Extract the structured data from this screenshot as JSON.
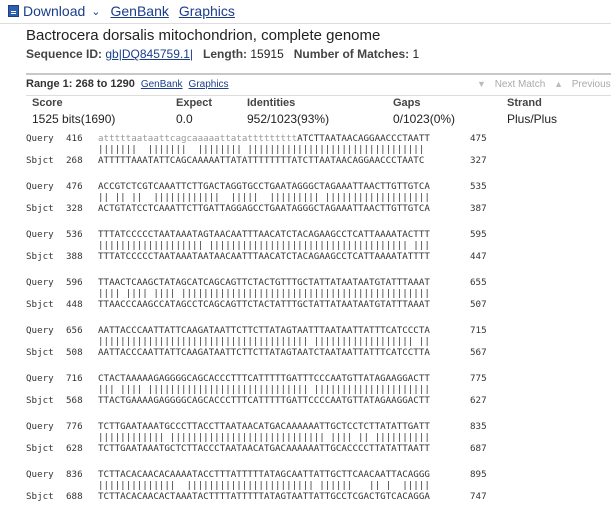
{
  "toolbar": {
    "download_label": "Download",
    "genbank_label": "GenBank",
    "graphics_label": "Graphics"
  },
  "header": {
    "title": "Bactrocera dorsalis mitochondrion, complete genome",
    "sequence_id_label": "Sequence ID:",
    "sequence_id_value": "gb|DQ845759.1|",
    "length_label": "Length:",
    "length_value": "15915",
    "matches_label": "Number of Matches:",
    "matches_value": "1"
  },
  "range": {
    "label": "Range 1: 268 to 1290",
    "genbank_link": "GenBank",
    "graphics_link": "Graphics",
    "next_match": "Next Match",
    "previous_match": "Previous Match"
  },
  "stats": {
    "headers": [
      "Score",
      "Expect",
      "Identities",
      "Gaps",
      "Strand"
    ],
    "values": [
      "1525 bits(1690)",
      "0.0",
      "952/1023(93%)",
      "0/1023(0%)",
      "Plus/Plus"
    ]
  },
  "alignment": [
    {
      "query_label": "Query",
      "query_start": "416",
      "query_lower": "atttttaataattcagcaaaaattatattttttttt",
      "query_seq": "ATCTTAATAACAGGAACCCTAATT",
      "query_end": "475",
      "match": "|||||||  |||||||  |||||||| ||||||||||||||||||||||||||||||||",
      "sbjct_label": "Sbjct",
      "sbjct_start": "268",
      "sbjct_seq": "ATTTTTAAATATTCAGCAAAAATTATATTTTTTTTATCTTAATAACAGGAACCCTAATC",
      "sbjct_end": "327"
    },
    {
      "query_label": "Query",
      "query_start": "476",
      "query_seq": "ACCGTCTCGTCAAATTCTTGACTAGGTGCCTGAATAGGGCTAGAAATTAACTTGTTGTCA",
      "query_end": "535",
      "match": "|| || ||  ||||||||||||  |||||  ||||||||| |||||||||||||||||||",
      "sbjct_label": "Sbjct",
      "sbjct_start": "328",
      "sbjct_seq": "ACTGTATCCTCAAATTCTTGATTAGGAGCCTGAATAGGGCTAGAAATTAACTTGTTGTCA",
      "sbjct_end": "387"
    },
    {
      "query_label": "Query",
      "query_start": "536",
      "query_seq": "TTTATCCCCCTAATAAATAGTAACAATTTAACATCTACAGAAGCCTCATTAAAATACTTT",
      "query_end": "595",
      "match": "||||||||||||||||||| |||||||||||||||||||||||||||||||||||| |||",
      "sbjct_label": "Sbjct",
      "sbjct_start": "388",
      "sbjct_seq": "TTTATCCCCCTAATAAATAATAACAATTTAACATCTACAGAAGCCTCATTAAAATATTTT",
      "sbjct_end": "447"
    },
    {
      "query_label": "Query",
      "query_start": "596",
      "query_seq": "TTAACTCAAGCTATAGCATCAGCAGTTCTACTGTTTGCTATTATAATAATGTATTTAAAT",
      "query_end": "655",
      "match": "|||| |||| |||| |||||||||||||||||||||||||||||||||||||||||||||",
      "sbjct_label": "Sbjct",
      "sbjct_start": "448",
      "sbjct_seq": "TTAACCCAAGCCATAGCCTCAGCAGTTCTACTATTTGCTATTATAATAATGTATTTAAAT",
      "sbjct_end": "507"
    },
    {
      "query_label": "Query",
      "query_start": "656",
      "query_seq": "AATTACCCAATTATTCAAGATAATTCTTCTTATAGTAATTTAATAATTATTTCATCCCTA",
      "query_end": "715",
      "match": "|||||||||||||||||||||||||||||||||||||| |||||||||||||||||| ||",
      "sbjct_label": "Sbjct",
      "sbjct_start": "508",
      "sbjct_seq": "AATTACCCAATTATTCAAGATAATTCTTCTTATAGTAATCTAATAATTATTTCATCCTTA",
      "sbjct_end": "567"
    },
    {
      "query_label": "Query",
      "query_start": "716",
      "query_seq": "CTACTAAAAAGAGGGGCAGCACCCTTTCATTTTTGATTTCCCAATGTTATAGAAGGACTT",
      "query_end": "775",
      "match": "||| |||| ||||||||||||||||||||||||||||| |||||||||||||||||||||",
      "sbjct_label": "Sbjct",
      "sbjct_start": "568",
      "sbjct_seq": "TTACTGAAAAGAGGGGCAGCACCCTTTCATTTTTGATTCCCCAATGTTATAGAAGGACTT",
      "sbjct_end": "627"
    },
    {
      "query_label": "Query",
      "query_start": "776",
      "query_seq": "TCTTGAATAAATGCCCTTACCTTAATAACATGACAAAAAATTGCTCCTCTTATATTGATT",
      "query_end": "835",
      "match": "|||||||||||| |||||||||||||||||||||||||||| |||| || ||||||||||",
      "sbjct_label": "Sbjct",
      "sbjct_start": "628",
      "sbjct_seq": "TCTTGAATAAATGCTCTTACCCTAATAACATGACAAAAAATTGCACCCCTTATATTAATT",
      "sbjct_end": "687"
    },
    {
      "query_label": "Query",
      "query_start": "836",
      "query_seq": "TCTTACACAACACAAAATACCTTTATTTTTATAGCAATTATTGCTTCAACAATTACAGGG",
      "query_end": "895",
      "match": "||||||||||||||  ||||||||||||||||||||||| ||||||   || |  |||||",
      "sbjct_label": "Sbjct",
      "sbjct_start": "688",
      "sbjct_seq": "TCTTACACAACACTAAATACTTTTATTTTTATAGTAATTATTGCCTCGACTGTCACAGGA",
      "sbjct_end": "747"
    }
  ]
}
